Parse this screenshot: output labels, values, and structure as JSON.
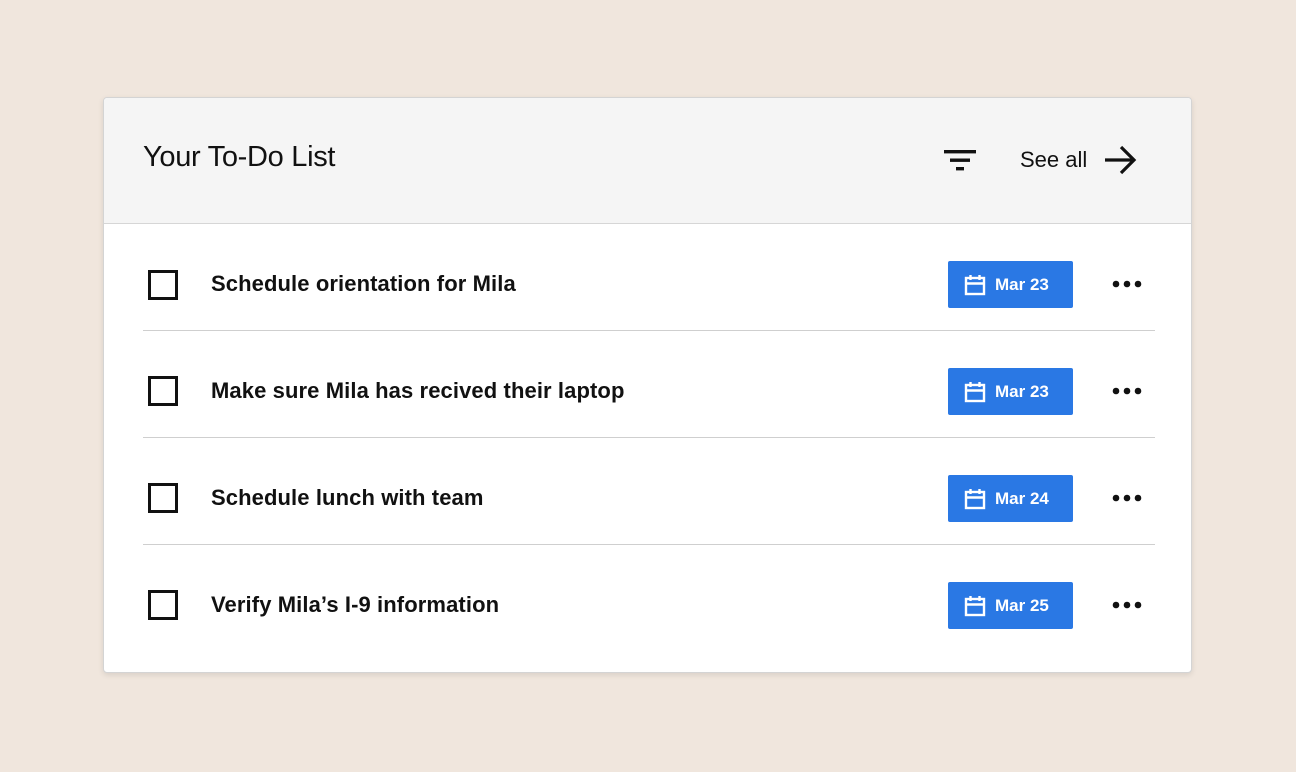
{
  "header": {
    "title": "Your To-Do List",
    "filter_icon": "filter-icon",
    "see_all_label": "See all",
    "see_all_icon": "arrow-right-icon"
  },
  "tasks": [
    {
      "label": "Schedule orientation for Mila",
      "date": "Mar 23",
      "checked": false
    },
    {
      "label": "Make sure Mila has recived their laptop",
      "date": "Mar 23",
      "checked": false
    },
    {
      "label": "Schedule lunch with team",
      "date": "Mar 24",
      "checked": false
    },
    {
      "label": "Verify Mila’s I-9 information",
      "date": "Mar 25",
      "checked": false
    }
  ],
  "icons": {
    "date": "calendar-icon",
    "more": "more-horizontal-icon"
  },
  "colors": {
    "background": "#f0e6dd",
    "header_bg": "#f5f5f5",
    "badge": "#2a78e4",
    "text": "#111111"
  }
}
